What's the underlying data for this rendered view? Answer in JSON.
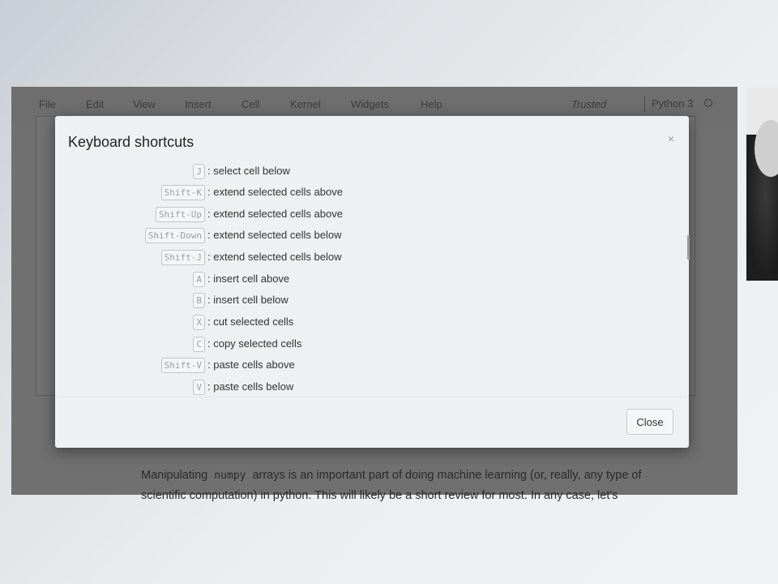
{
  "menu": {
    "items": [
      "File",
      "Edit",
      "View",
      "Insert",
      "Cell",
      "Kernel",
      "Widgets",
      "Help"
    ],
    "trusted_label": "Trusted",
    "kernel_label": "Python 3"
  },
  "modal": {
    "title": "Keyboard shortcuts",
    "close_x": "×",
    "shortcuts": [
      {
        "keys": "J",
        "description": ": select cell below"
      },
      {
        "keys": "Shift-K",
        "description": ": extend selected cells above"
      },
      {
        "keys": "Shift-Up",
        "description": ": extend selected cells above"
      },
      {
        "keys": "Shift-Down",
        "description": ": extend selected cells below"
      },
      {
        "keys": "Shift-J",
        "description": ": extend selected cells below"
      },
      {
        "keys": "A",
        "description": ": insert cell above"
      },
      {
        "keys": "B",
        "description": ": insert cell below"
      },
      {
        "keys": "X",
        "description": ": cut selected cells"
      },
      {
        "keys": "C",
        "description": ": copy selected cells"
      },
      {
        "keys": "Shift-V",
        "description": ": paste cells above"
      },
      {
        "keys": "V",
        "description": ": paste cells below"
      }
    ],
    "close_button": "Close"
  },
  "notebook": {
    "line1_before": "Manipulating",
    "line1_code": "numpy",
    "line1_after": "arrays is an important part of doing machine learning (or, really, any type of",
    "line2": "scientific computation) in python. This will likely be a short review for most. In any case, let's"
  },
  "colors": {
    "modal_bg": "#eef0f1",
    "dimmed_bg": "#707070"
  }
}
